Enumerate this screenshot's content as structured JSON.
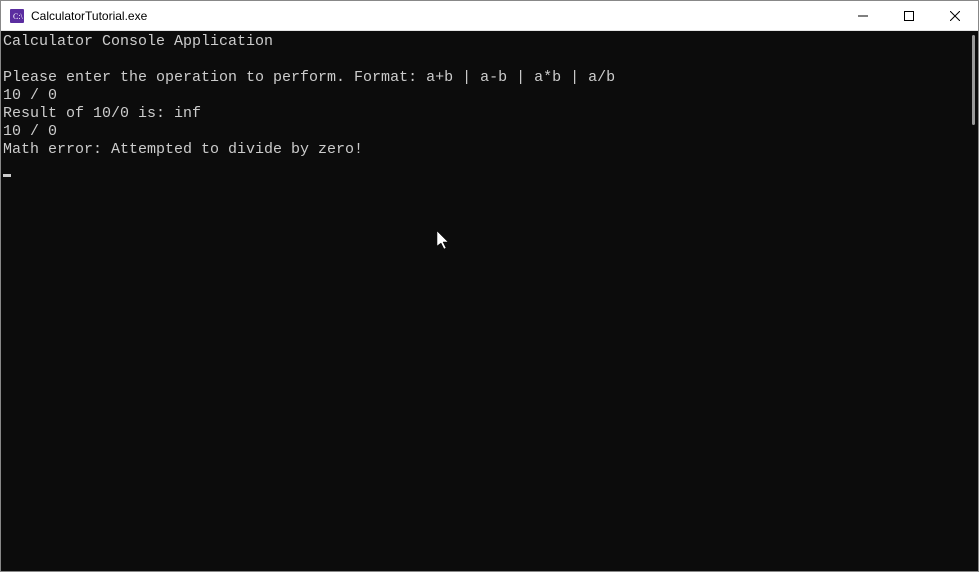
{
  "window": {
    "title": "CalculatorTutorial.exe"
  },
  "console": {
    "lines": [
      "Calculator Console Application",
      "",
      "Please enter the operation to perform. Format: a+b | a-b | a*b | a/b",
      "10 / 0",
      "Result of 10/0 is: inf",
      "10 / 0",
      "Math error: Attempted to divide by zero!"
    ]
  }
}
